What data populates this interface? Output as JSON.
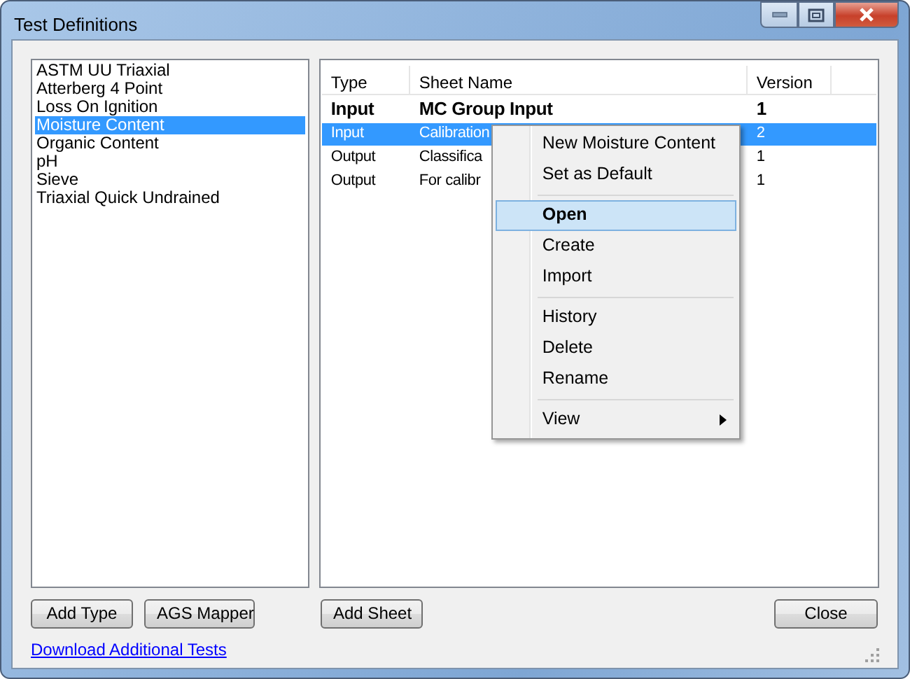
{
  "window": {
    "title": "Test Definitions"
  },
  "test_types": [
    {
      "label": "ASTM UU Triaxial",
      "selected": false
    },
    {
      "label": "Atterberg 4 Point",
      "selected": false
    },
    {
      "label": "Loss On Ignition",
      "selected": false
    },
    {
      "label": "Moisture Content",
      "selected": true
    },
    {
      "label": "Organic Content",
      "selected": false
    },
    {
      "label": "pH",
      "selected": false
    },
    {
      "label": "Sieve",
      "selected": false
    },
    {
      "label": "Triaxial Quick Undrained",
      "selected": false
    }
  ],
  "sheets": {
    "columns": [
      "Type",
      "Sheet Name",
      "Version"
    ],
    "rows": [
      {
        "cells": [
          "Input",
          "MC Group Input",
          "1"
        ],
        "bold": true,
        "selected": false
      },
      {
        "cells": [
          "Input",
          "Calibration",
          "2"
        ],
        "bold": false,
        "selected": true
      },
      {
        "cells": [
          "Output",
          "Classifica",
          "1"
        ],
        "bold": false,
        "selected": false
      },
      {
        "cells": [
          "Output",
          "For calibr",
          "1"
        ],
        "bold": false,
        "selected": false
      }
    ]
  },
  "context_menu": [
    {
      "label": "New Moisture Content",
      "highlighted": false
    },
    {
      "label": "Set as Default",
      "highlighted": false,
      "separator_after": true
    },
    {
      "label": "Open",
      "highlighted": true,
      "bold": true
    },
    {
      "label": "Create",
      "highlighted": false
    },
    {
      "label": "Import",
      "highlighted": false,
      "separator_after": true
    },
    {
      "label": "History",
      "highlighted": false
    },
    {
      "label": "Delete",
      "highlighted": false
    },
    {
      "label": "Rename",
      "highlighted": false,
      "separator_after": true
    },
    {
      "label": "View",
      "highlighted": false,
      "submenu": true
    }
  ],
  "buttons_left": [
    "Add Type",
    "AGS Mapper"
  ],
  "button_sheet": "Add Sheet",
  "button_close": "Close",
  "link": "Download Additional Tests"
}
